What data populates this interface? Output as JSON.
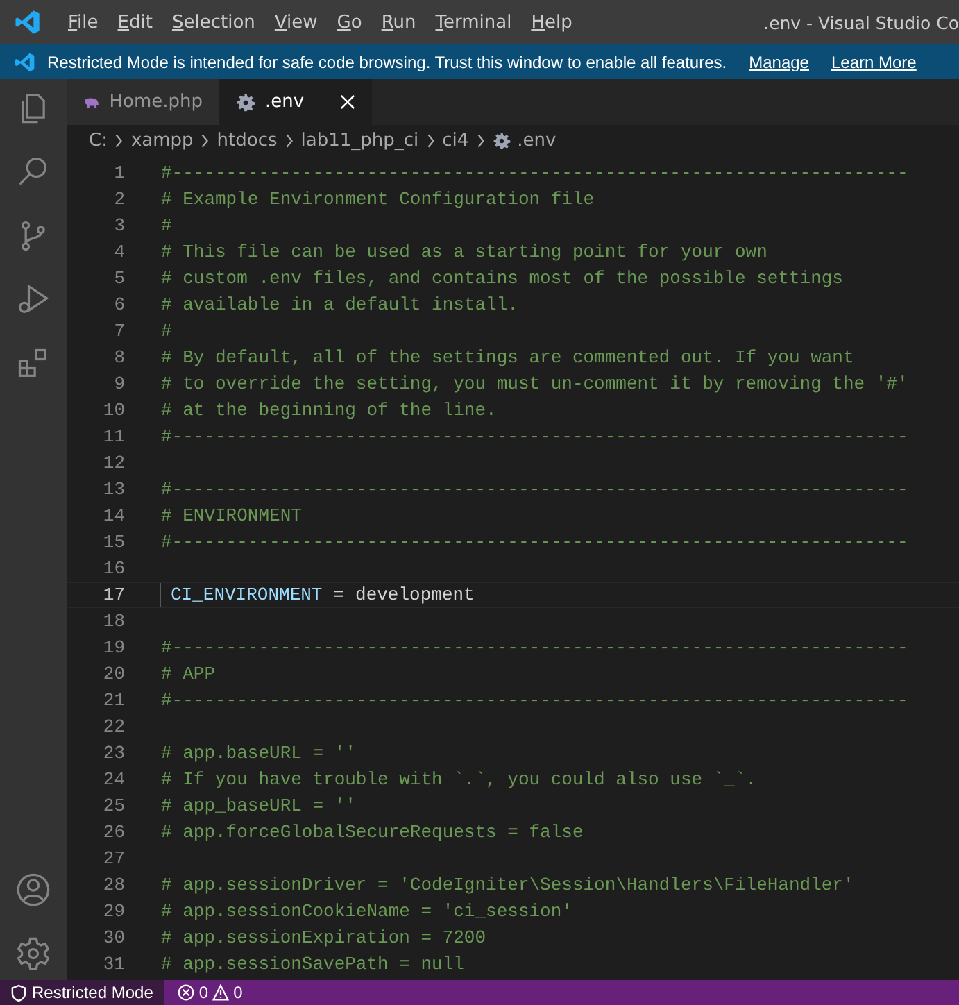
{
  "window": {
    "title": ".env - Visual Studio Co"
  },
  "menu": [
    "File",
    "Edit",
    "Selection",
    "View",
    "Go",
    "Run",
    "Terminal",
    "Help"
  ],
  "banner": {
    "message": "Restricted Mode is intended for safe code browsing. Trust this window to enable all features.",
    "links": [
      "Manage",
      "Learn More"
    ]
  },
  "tabs": [
    {
      "label": "Home.php",
      "kind": "php",
      "selected": false
    },
    {
      "label": ".env",
      "kind": "config",
      "selected": true
    }
  ],
  "breadcrumb": [
    "C:",
    "xampp",
    "htdocs",
    "lab11_php_ci",
    "ci4",
    ".env"
  ],
  "editor": {
    "lines": [
      {
        "number": "1",
        "kind": "comment",
        "text": "#--------------------------------------------------------------------",
        "current": false
      },
      {
        "number": "2",
        "kind": "comment",
        "text": "# Example Environment Configuration file",
        "current": false
      },
      {
        "number": "3",
        "kind": "comment",
        "text": "#",
        "current": false
      },
      {
        "number": "4",
        "kind": "comment",
        "text": "# This file can be used as a starting point for your own",
        "current": false
      },
      {
        "number": "5",
        "kind": "comment",
        "text": "# custom .env files, and contains most of the possible settings",
        "current": false
      },
      {
        "number": "6",
        "kind": "comment",
        "text": "# available in a default install.",
        "current": false
      },
      {
        "number": "7",
        "kind": "comment",
        "text": "#",
        "current": false
      },
      {
        "number": "8",
        "kind": "comment",
        "text": "# By default, all of the settings are commented out. If you want",
        "current": false
      },
      {
        "number": "9",
        "kind": "comment",
        "text": "# to override the setting, you must un-comment it by removing the '#'",
        "current": false
      },
      {
        "number": "10",
        "kind": "comment",
        "text": "# at the beginning of the line.",
        "current": false
      },
      {
        "number": "11",
        "kind": "comment",
        "text": "#--------------------------------------------------------------------",
        "current": false
      },
      {
        "number": "12",
        "kind": "blank",
        "current": false
      },
      {
        "number": "13",
        "kind": "comment",
        "text": "#--------------------------------------------------------------------",
        "current": false
      },
      {
        "number": "14",
        "kind": "comment",
        "text": "# ENVIRONMENT",
        "current": false
      },
      {
        "number": "15",
        "kind": "comment",
        "text": "#--------------------------------------------------------------------",
        "current": false
      },
      {
        "number": "16",
        "kind": "blank",
        "current": false
      },
      {
        "number": "17",
        "kind": "assignment",
        "key": "CI_ENVIRONMENT",
        "operator": "=",
        "value": "development",
        "current": true
      },
      {
        "number": "18",
        "kind": "blank",
        "current": false
      },
      {
        "number": "19",
        "kind": "comment",
        "text": "#--------------------------------------------------------------------",
        "current": false
      },
      {
        "number": "20",
        "kind": "comment",
        "text": "# APP",
        "current": false
      },
      {
        "number": "21",
        "kind": "comment",
        "text": "#--------------------------------------------------------------------",
        "current": false
      },
      {
        "number": "22",
        "kind": "blank",
        "current": false
      },
      {
        "number": "23",
        "kind": "comment",
        "text": "# app.baseURL = ''",
        "current": false
      },
      {
        "number": "24",
        "kind": "comment",
        "text": "# If you have trouble with `.`, you could also use `_`.",
        "current": false
      },
      {
        "number": "25",
        "kind": "comment",
        "text": "# app_baseURL = ''",
        "current": false
      },
      {
        "number": "26",
        "kind": "comment",
        "text": "# app.forceGlobalSecureRequests = false",
        "current": false
      },
      {
        "number": "27",
        "kind": "blank",
        "current": false
      },
      {
        "number": "28",
        "kind": "comment",
        "text": "# app.sessionDriver = 'CodeIgniter\\Session\\Handlers\\FileHandler'",
        "current": false
      },
      {
        "number": "29",
        "kind": "comment",
        "text": "# app.sessionCookieName = 'ci_session'",
        "current": false
      },
      {
        "number": "30",
        "kind": "comment",
        "text": "# app.sessionExpiration = 7200",
        "current": false
      },
      {
        "number": "31",
        "kind": "comment",
        "text": "# app.sessionSavePath = null",
        "current": false
      }
    ]
  },
  "status_bar": {
    "mode": "Restricted Mode",
    "errors": "0",
    "warnings": "0"
  }
}
